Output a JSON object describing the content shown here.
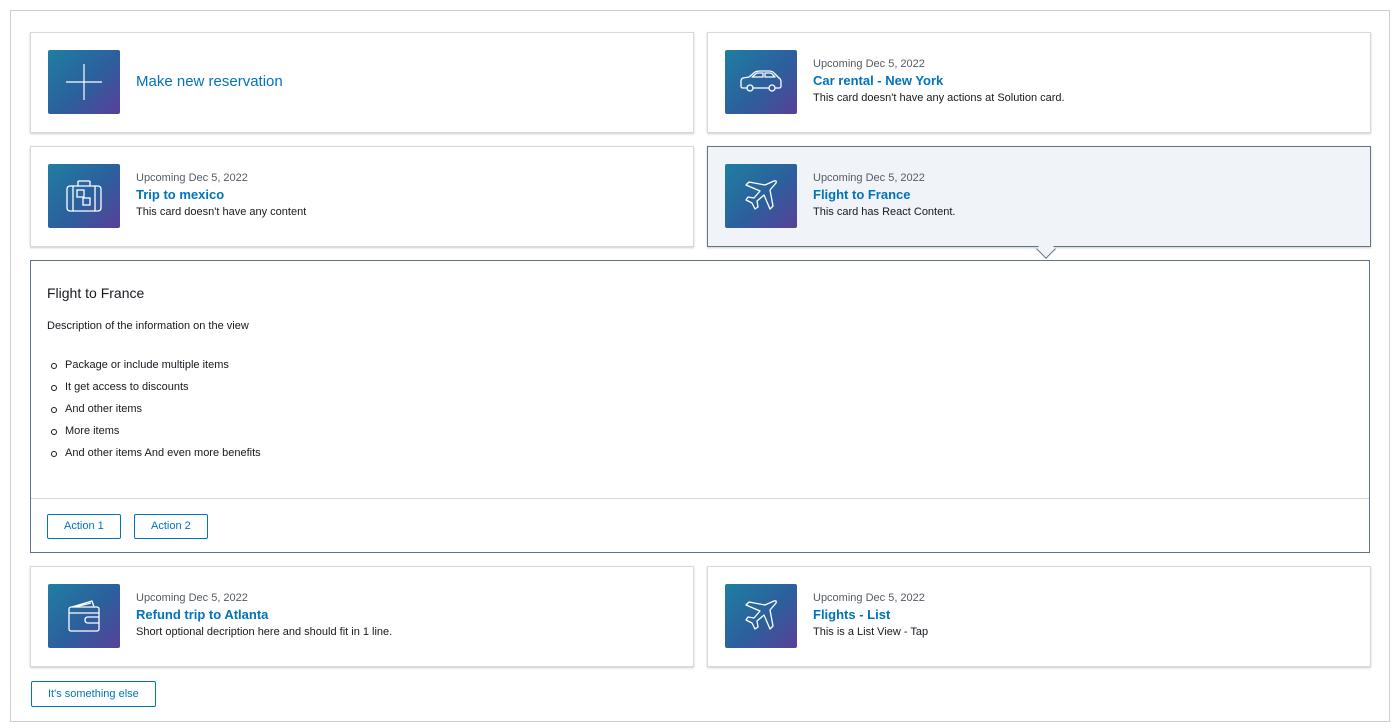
{
  "cards": {
    "new_reservation": {
      "label": "Make new reservation",
      "icon": "plus-icon"
    },
    "car_rental": {
      "meta": "Upcoming Dec 5, 2022",
      "title": "Car rental - New York",
      "description": "This card doesn't have any actions at Solution card.",
      "icon": "car-icon"
    },
    "trip_mexico": {
      "meta": "Upcoming Dec 5, 2022",
      "title": "Trip to mexico",
      "description": "This card doesn't have any content",
      "icon": "suitcase-icon"
    },
    "flight_france": {
      "meta": "Upcoming Dec 5, 2022",
      "title": "Flight to France",
      "description": "This card has React Content.",
      "icon": "airplane-icon",
      "selected": true
    },
    "refund_atlanta": {
      "meta": "Upcoming Dec 5, 2022",
      "title": "Refund trip to Atlanta",
      "description": "Short optional decription here and should fit in 1 line.",
      "icon": "wallet-icon"
    },
    "flights_list": {
      "meta": "Upcoming Dec 5, 2022",
      "title": "Flights - List",
      "description": "This is a List View - Tap",
      "icon": "airplane-icon"
    }
  },
  "detail": {
    "title": "Flight to France",
    "description": "Description of the information on the view",
    "items": [
      "Package or include multiple items",
      "It get access to discounts",
      "And other items",
      "More items",
      "And other items And even more benefits"
    ],
    "actions": [
      "Action 1",
      "Action 2"
    ]
  },
  "footer": {
    "else_button": "It's something else"
  },
  "colors": {
    "link": "#0073bb",
    "selected_bg": "#f0f4f8",
    "selected_border": "#627487",
    "tile_gradient_start": "#1f7ea1",
    "tile_gradient_end": "#5a3f98"
  }
}
